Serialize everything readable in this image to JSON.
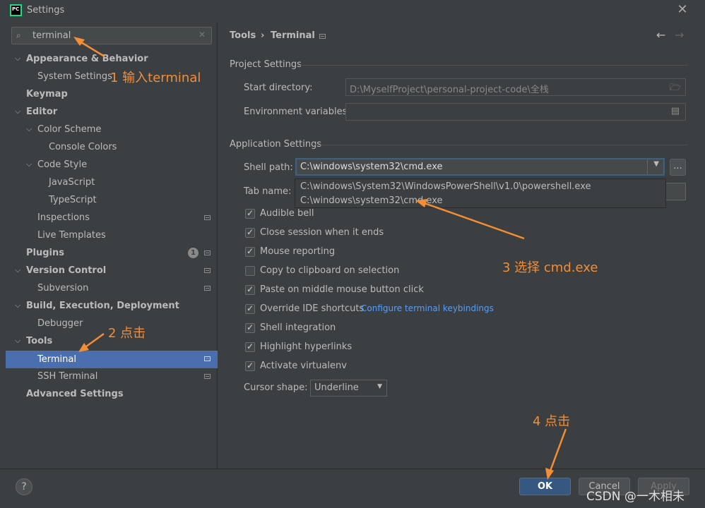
{
  "window": {
    "title": "Settings",
    "logo_text": "PC"
  },
  "search": {
    "value": "terminal"
  },
  "sidebar": {
    "items": [
      {
        "label": "Appearance & Behavior"
      },
      {
        "label": "System Settings"
      },
      {
        "label": "Keymap"
      },
      {
        "label": "Editor"
      },
      {
        "label": "Color Scheme"
      },
      {
        "label": "Console Colors"
      },
      {
        "label": "Code Style"
      },
      {
        "label": "JavaScript"
      },
      {
        "label": "TypeScript"
      },
      {
        "label": "Inspections"
      },
      {
        "label": "Live Templates"
      },
      {
        "label": "Plugins"
      },
      {
        "label": "Version Control"
      },
      {
        "label": "Subversion"
      },
      {
        "label": "Build, Execution, Deployment"
      },
      {
        "label": "Debugger"
      },
      {
        "label": "Tools"
      },
      {
        "label": "Terminal"
      },
      {
        "label": "SSH Terminal"
      },
      {
        "label": "Advanced Settings"
      }
    ],
    "plugins_badge": "1",
    "selected": "Terminal"
  },
  "breadcrumb": {
    "parent": "Tools",
    "sep": "›",
    "current": "Terminal"
  },
  "project": {
    "title": "Project Settings",
    "start_dir_label": "Start directory:",
    "start_dir_value": "D:\\MyselfProject\\personal-project-code\\全栈",
    "env_label": "Environment variables:",
    "env_value": ""
  },
  "app": {
    "title": "Application Settings",
    "shell_label": "Shell path:",
    "shell_value": "C:\\windows\\system32\\cmd.exe",
    "shell_options": [
      "C:\\windows\\System32\\WindowsPowerShell\\v1.0\\powershell.exe",
      "C:\\windows\\system32\\cmd.exe"
    ],
    "tab_label": "Tab name:",
    "more_button": "...",
    "checkboxes": [
      {
        "label": "Audible bell",
        "checked": true
      },
      {
        "label": "Close session when it ends",
        "checked": true
      },
      {
        "label": "Mouse reporting",
        "checked": true
      },
      {
        "label": "Copy to clipboard on selection",
        "checked": false
      },
      {
        "label": "Paste on middle mouse button click",
        "checked": true
      },
      {
        "label": "Override IDE shortcuts",
        "checked": true
      },
      {
        "label": "Shell integration",
        "checked": true
      },
      {
        "label": "Highlight hyperlinks",
        "checked": true
      },
      {
        "label": "Activate virtualenv",
        "checked": true
      }
    ],
    "keybindings_link": "Configure terminal keybindings",
    "cursor_label": "Cursor shape:",
    "cursor_value": "Underline"
  },
  "buttons": {
    "ok": "OK",
    "cancel": "Cancel",
    "apply": "Apply",
    "help": "?"
  },
  "annotations": {
    "step1": "1 输入terminal",
    "step2": "2 点击",
    "step3": "3 选择 cmd.exe",
    "step4": "4 点击"
  },
  "watermark": "CSDN @一木相未",
  "colors": {
    "accent": "#4b6eaf",
    "annotation": "#f48d36",
    "primary_button": "#365880"
  }
}
